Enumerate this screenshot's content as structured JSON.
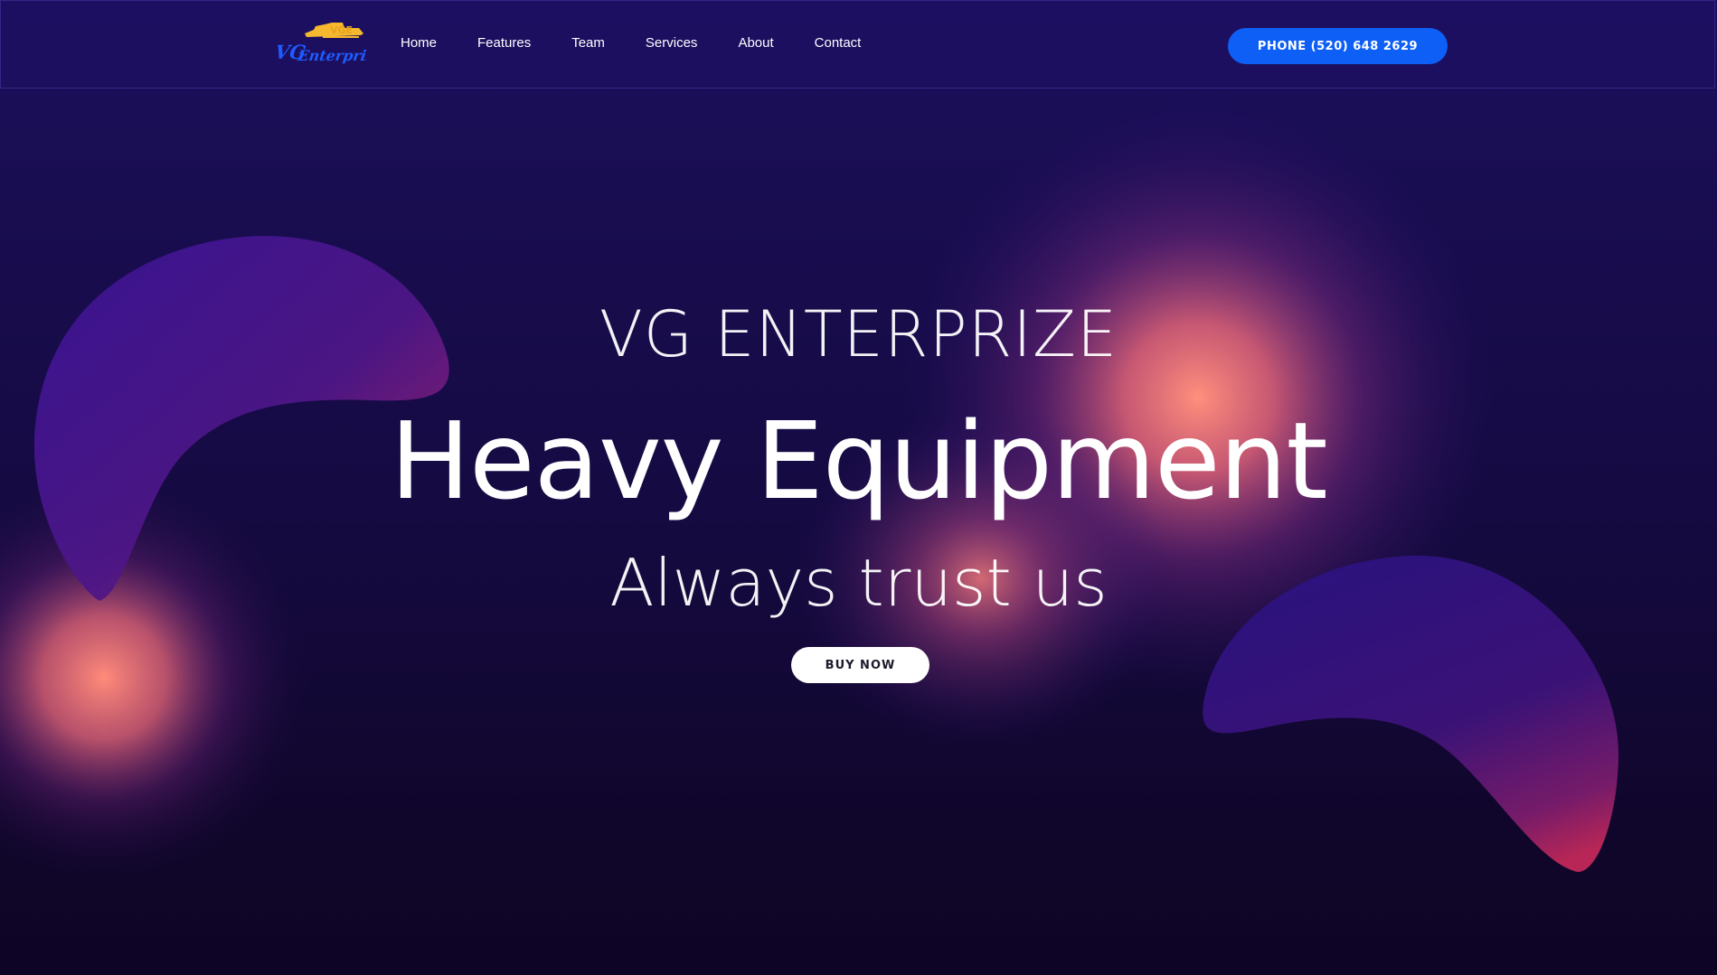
{
  "brand": {
    "logo_text": "VG Enterprize",
    "logo_badge": "VGE",
    "logo_colors": {
      "script": "#1e5bff",
      "badge": "#f5b82e"
    }
  },
  "nav": {
    "items": [
      {
        "label": "Home"
      },
      {
        "label": "Features"
      },
      {
        "label": "Team"
      },
      {
        "label": "Services"
      },
      {
        "label": "About"
      },
      {
        "label": "Contact"
      }
    ],
    "phone_label": "PHONE (520) 648 2629"
  },
  "hero": {
    "kicker": "VG ENTERPRIZE",
    "title": "Heavy Equipment",
    "tagline": "Always trust us",
    "cta_label": "BUY NOW"
  },
  "colors": {
    "background_top": "#1c0f5e",
    "background_bottom": "#0e0525",
    "glow": "#ff8a78",
    "accent_blue": "#0e5ff5",
    "blob_edge": "#d1245c"
  }
}
